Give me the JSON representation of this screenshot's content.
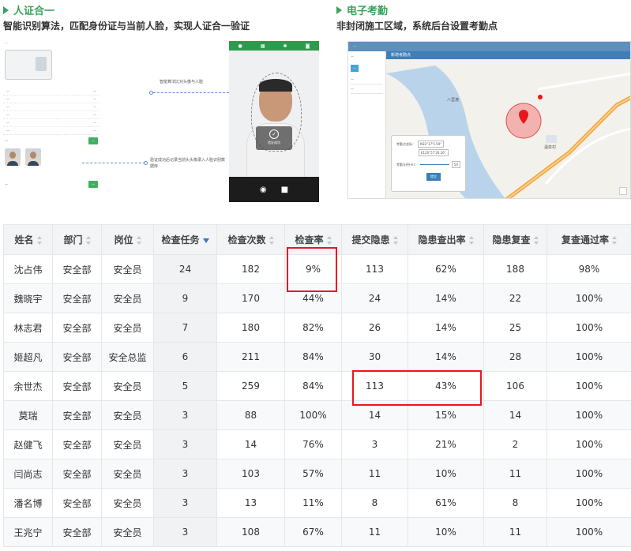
{
  "sections": {
    "left": {
      "title": "人证合一",
      "subtitle": "智能识别算法，匹配身份证与当前人脸，实现人证合一验证",
      "annotation_top": "智能算法比对头像与人脸",
      "annotation_bottom": "验证成功后记录当前头头像录入人脸识别数据库",
      "phone_ok_text": "验证成功"
    },
    "right": {
      "title": "电子考勤",
      "subtitle": "非封闭施工区域，系统后台设置考勤点",
      "map_modal_title": "新增考勤点",
      "form_coord_label": "考勤点坐标：",
      "form_coord_value1": "N32°17'5.59\"",
      "form_coord_value2": "E120°57'26.26\"",
      "form_radius_label": "考勤半径(m)：",
      "form_radius_value": "50",
      "form_submit": "提交",
      "map_place_labels": [
        "八里港",
        "温泉村"
      ]
    }
  },
  "table": {
    "headers": [
      "姓名",
      "部门",
      "岗位",
      "检查任务",
      "检查次数",
      "检查率",
      "提交隐患",
      "隐患查出率",
      "隐患复查",
      "复查通过率"
    ],
    "rows": [
      [
        "沈占伟",
        "安全部",
        "安全员",
        "24",
        "182",
        "9%",
        "113",
        "62%",
        "188",
        "98%"
      ],
      [
        "魏晓宇",
        "安全部",
        "安全员",
        "9",
        "170",
        "44%",
        "24",
        "14%",
        "22",
        "100%"
      ],
      [
        "林志君",
        "安全部",
        "安全员",
        "7",
        "180",
        "82%",
        "26",
        "14%",
        "25",
        "100%"
      ],
      [
        "姬超凡",
        "安全部",
        "安全总监",
        "6",
        "211",
        "84%",
        "30",
        "14%",
        "28",
        "100%"
      ],
      [
        "余世杰",
        "安全部",
        "安全员",
        "5",
        "259",
        "84%",
        "113",
        "43%",
        "106",
        "100%"
      ],
      [
        "莫瑞",
        "安全部",
        "安全员",
        "3",
        "88",
        "100%",
        "14",
        "15%",
        "14",
        "100%"
      ],
      [
        "赵健飞",
        "安全部",
        "安全员",
        "3",
        "14",
        "76%",
        "3",
        "21%",
        "2",
        "100%"
      ],
      [
        "闫尚志",
        "安全部",
        "安全员",
        "3",
        "103",
        "57%",
        "11",
        "10%",
        "11",
        "100%"
      ],
      [
        "潘名博",
        "安全部",
        "安全员",
        "3",
        "13",
        "11%",
        "8",
        "61%",
        "8",
        "100%"
      ],
      [
        "王兆宁",
        "安全部",
        "安全员",
        "3",
        "108",
        "67%",
        "11",
        "10%",
        "11",
        "100%"
      ]
    ],
    "sorted_column": 3,
    "sort_direction": "desc"
  },
  "colors": {
    "accent_green": "#3aa15a",
    "highlight_red": "#e8171d",
    "sort_blue": "#3f72c8"
  }
}
